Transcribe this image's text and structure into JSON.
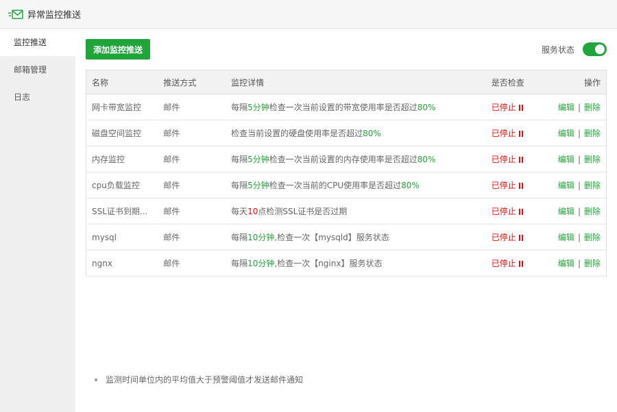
{
  "window": {
    "title": "异常监控推送",
    "icon": "envelope-send-icon"
  },
  "sidebar": {
    "items": [
      {
        "label": "监控推送",
        "active": true
      },
      {
        "label": "邮箱管理",
        "active": false
      },
      {
        "label": "日志",
        "active": false
      }
    ]
  },
  "toolbar": {
    "add_label": "添加监控推送",
    "service_status_label": "服务状态",
    "service_on": true
  },
  "table": {
    "headers": [
      "名称",
      "推送方式",
      "监控详情",
      "是否检查",
      "操作"
    ],
    "rows": [
      {
        "name": "网卡带宽监控",
        "method": "邮件",
        "detail": [
          {
            "t": "每隔",
            "c": ""
          },
          {
            "t": "5分钟",
            "c": "green"
          },
          {
            "t": "检查一次当前设置的带宽使用率是否超过",
            "c": ""
          },
          {
            "t": "80%",
            "c": "green"
          }
        ],
        "status": "已停止",
        "edit": "编辑",
        "sep": "|",
        "delete": "删除"
      },
      {
        "name": "磁盘空间监控",
        "method": "邮件",
        "detail": [
          {
            "t": "检查当前设置的硬盘使用率是否超过",
            "c": ""
          },
          {
            "t": "80%",
            "c": "green"
          }
        ],
        "status": "已停止",
        "edit": "编辑",
        "sep": "|",
        "delete": "删除"
      },
      {
        "name": "内存监控",
        "method": "邮件",
        "detail": [
          {
            "t": "每隔",
            "c": ""
          },
          {
            "t": "5分钟",
            "c": "green"
          },
          {
            "t": "检查一次当前设置的内存使用率是否超过",
            "c": ""
          },
          {
            "t": "80%",
            "c": "green"
          }
        ],
        "status": "已停止",
        "edit": "编辑",
        "sep": "|",
        "delete": "删除"
      },
      {
        "name": "cpu负载监控",
        "method": "邮件",
        "detail": [
          {
            "t": "每隔",
            "c": ""
          },
          {
            "t": "5分钟",
            "c": "green"
          },
          {
            "t": "检查一次当前的CPU使用率是否超过",
            "c": ""
          },
          {
            "t": "80%",
            "c": "green"
          }
        ],
        "status": "已停止",
        "edit": "编辑",
        "sep": "|",
        "delete": "删除"
      },
      {
        "name": "SSL证书到期...",
        "method": "邮件",
        "detail": [
          {
            "t": "每天",
            "c": ""
          },
          {
            "t": "10",
            "c": "red"
          },
          {
            "t": "点检测SSL证书是否过期",
            "c": ""
          }
        ],
        "status": "已停止",
        "edit": "编辑",
        "sep": "|",
        "delete": "删除"
      },
      {
        "name": "mysql",
        "method": "邮件",
        "detail": [
          {
            "t": "每隔",
            "c": ""
          },
          {
            "t": "10分钟",
            "c": "green"
          },
          {
            "t": ",检查一次【mysqld】服务状态",
            "c": ""
          }
        ],
        "status": "已停止",
        "edit": "编辑",
        "sep": "|",
        "delete": "删除"
      },
      {
        "name": "ngnx",
        "method": "邮件",
        "detail": [
          {
            "t": "每隔",
            "c": ""
          },
          {
            "t": "10分钟",
            "c": "green"
          },
          {
            "t": ",检查一次【nginx】服务状态",
            "c": ""
          }
        ],
        "status": "已停止",
        "edit": "编辑",
        "sep": "|",
        "delete": "删除"
      }
    ]
  },
  "footer_note": "监测时间单位内的平均值大于预警阈值才发送邮件通知",
  "colors": {
    "accent": "#20a53a",
    "danger": "#ef0808"
  }
}
